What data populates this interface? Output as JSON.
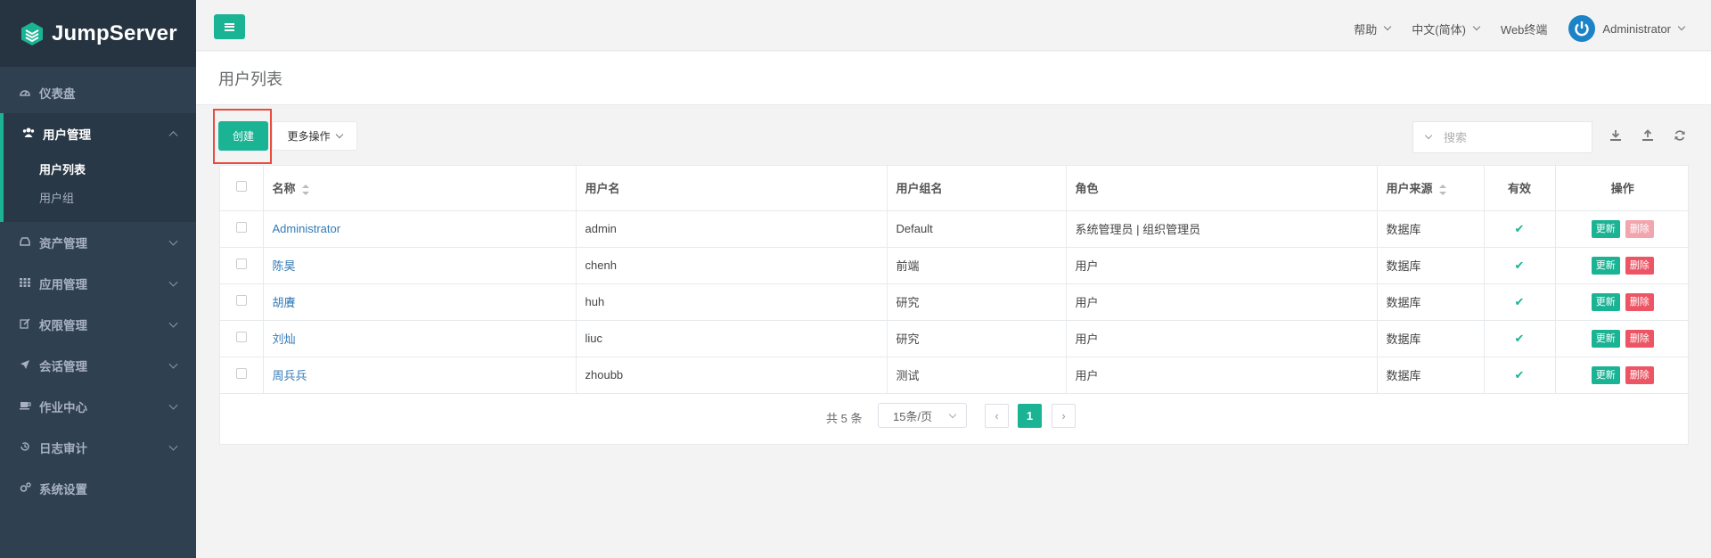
{
  "brand": {
    "name": "JumpServer",
    "color": "#1ab394",
    "sidebar_bg": "#2f4050"
  },
  "sidebar": {
    "items": [
      {
        "label": "仪表盘",
        "icon": "dashboard-icon"
      },
      {
        "label": "用户管理",
        "icon": "users-icon",
        "expanded": true,
        "children": [
          {
            "label": "用户列表",
            "selected": true
          },
          {
            "label": "用户组",
            "selected": false
          }
        ]
      },
      {
        "label": "资产管理",
        "icon": "inbox-icon"
      },
      {
        "label": "应用管理",
        "icon": "grid-icon"
      },
      {
        "label": "权限管理",
        "icon": "edit-icon"
      },
      {
        "label": "会话管理",
        "icon": "rocket-icon"
      },
      {
        "label": "作业中心",
        "icon": "coffee-icon"
      },
      {
        "label": "日志审计",
        "icon": "history-icon"
      },
      {
        "label": "系统设置",
        "icon": "gears-icon"
      }
    ]
  },
  "header": {
    "help": "帮助",
    "language": "中文(简体)",
    "web_terminal": "Web终端",
    "user": "Administrator"
  },
  "page": {
    "title": "用户列表"
  },
  "toolbar": {
    "create": "创建",
    "more_actions": "更多操作",
    "search_placeholder": "搜索"
  },
  "table": {
    "columns": [
      "名称",
      "用户名",
      "用户组名",
      "角色",
      "用户来源",
      "有效",
      "操作"
    ],
    "rows": [
      {
        "name": "Administrator",
        "username": "admin",
        "group": "Default",
        "role": "系统管理员 | 组织管理员",
        "source": "数据库",
        "valid": "✔",
        "update": "更新",
        "delete": "删除",
        "delete_disabled": true
      },
      {
        "name": "陈昊",
        "username": "chenh",
        "group": "前端",
        "role": "用户",
        "source": "数据库",
        "valid": "✔",
        "update": "更新",
        "delete": "删除",
        "delete_disabled": false
      },
      {
        "name": "胡賡",
        "username": "huh",
        "group": "研究",
        "role": "用户",
        "source": "数据库",
        "valid": "✔",
        "update": "更新",
        "delete": "删除",
        "delete_disabled": false
      },
      {
        "name": "刘灿",
        "username": "liuc",
        "group": "研究",
        "role": "用户",
        "source": "数据库",
        "valid": "✔",
        "update": "更新",
        "delete": "删除",
        "delete_disabled": false
      },
      {
        "name": "周兵兵",
        "username": "zhoubb",
        "group": "测试",
        "role": "用户",
        "source": "数据库",
        "valid": "✔",
        "update": "更新",
        "delete": "删除",
        "delete_disabled": false
      }
    ]
  },
  "pagination": {
    "total": "共 5 条",
    "per_page": "15条/页",
    "current_page": "1"
  }
}
